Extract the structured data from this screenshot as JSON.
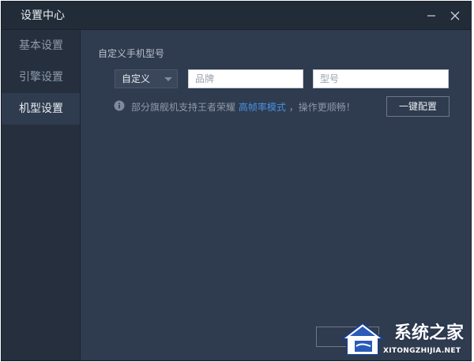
{
  "window": {
    "title": "设置中心"
  },
  "sidebar": {
    "items": [
      {
        "label": "基本设置",
        "active": false
      },
      {
        "label": "引擎设置",
        "active": false
      },
      {
        "label": "机型设置",
        "active": true
      }
    ]
  },
  "main": {
    "section_label": "自定义手机型号",
    "select_value": "自定义",
    "brand_placeholder": "品牌",
    "model_placeholder": "型号",
    "tip_before": "部分旗舰机支持王者荣耀",
    "tip_link": "高帧率模式",
    "tip_after": "，操作更顺畅！",
    "one_click_label": "一键配置"
  },
  "watermark": {
    "title": "系统之家",
    "url": "XITONGZHIJIA.NET"
  },
  "colors": {
    "window_bg": "#2f3b4e",
    "sidebar_bg": "#252f3e",
    "titlebar_bg": "#222b38",
    "link": "#4a90e2"
  },
  "icons": {
    "minimize": "minimize-icon",
    "close": "close-icon",
    "dropdown": "chevron-down-icon",
    "info": "info-icon",
    "logo": "house-logo-icon"
  }
}
